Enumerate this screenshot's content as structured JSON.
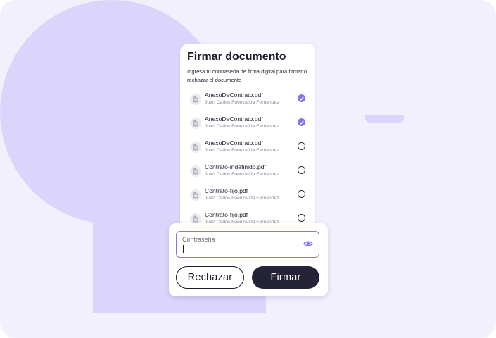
{
  "card": {
    "title": "Firmar documento",
    "subtitle": "Ingresa tu contraseña de firma digital para firmar o rechazar el documento"
  },
  "files": [
    {
      "name": "AnexoDeContrato.pdf",
      "owner": "Juan Carlos Fuenzalida Fernandez",
      "checked": true
    },
    {
      "name": "AnexoDeContrato.pdf",
      "owner": "Juan Carlos Fuenzalida Fernandez",
      "checked": true
    },
    {
      "name": "AnexoDeContrato.pdf",
      "owner": "Juan Carlos Fuenzalida Fernandez",
      "checked": false
    },
    {
      "name": "Contrato-indefinido.pdf",
      "owner": "Juan Carlos Fuenzalida Fernandez",
      "checked": false
    },
    {
      "name": "Contrato-fijo.pdf",
      "owner": "Juan Carlos Fuenzalida Fernandez",
      "checked": false
    },
    {
      "name": "Contrato-fijo.pdf",
      "owner": "Juan Carlos Fuenzalida Fernandez",
      "checked": false
    }
  ],
  "panel": {
    "password_label": "Contraseña",
    "password_value": "",
    "reject_label": "Rechazar",
    "sign_label": "Firmar"
  },
  "colors": {
    "accent": "#8e72ec",
    "background": "#f2f0fd",
    "shape": "#dcd5fb",
    "primary_button": "#242338"
  },
  "icons": {
    "file": "document-icon",
    "checked": "check-circle-icon",
    "unchecked": "empty-circle-icon",
    "password_toggle": "eye-icon"
  }
}
